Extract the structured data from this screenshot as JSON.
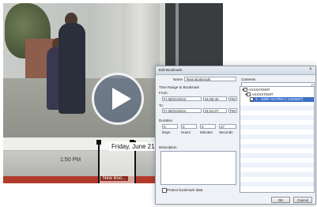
{
  "player": {
    "timeline_time": "1:50 PM",
    "timeline_date": "Friday, June 21,",
    "bookmark_label": "New Boo..."
  },
  "dialog": {
    "title": "Edit Bookmark",
    "name_label": "Name",
    "name_value": "New Bookmark",
    "time_range_header": "Time Range to Bookmark",
    "from_label": "From:",
    "from_day": "Fr",
    "from_date": "06/21/2013",
    "from_time": "01:50:40",
    "from_ampm": "PM",
    "to_label": "To:",
    "to_day": "Fr",
    "to_date": "06/21/2013",
    "to_time": "01:51:07",
    "to_ampm": "PM",
    "duration_label": "Duration",
    "duration_days": "0",
    "duration_hours": "0",
    "duration_minutes": "0",
    "duration_seconds": "27",
    "days_label": "Days",
    "hours_label": "Hours",
    "minutes_label": "Minutes",
    "seconds_label": "Seconds",
    "description_label": "Description",
    "protect_label": "Protect bookmark data",
    "cameras_label": "Cameras",
    "camera_tree": [
      {
        "label": "AXXXXTEMT",
        "indent": 0,
        "selected": false
      },
      {
        "label": "AXXXXTEMT",
        "indent": 1,
        "selected": false
      },
      {
        "label": "  1 - 18DF-AO PRO (-1234567)",
        "indent": 2,
        "selected": true
      }
    ],
    "ok_label": "OK",
    "cancel_label": "Cancel"
  }
}
